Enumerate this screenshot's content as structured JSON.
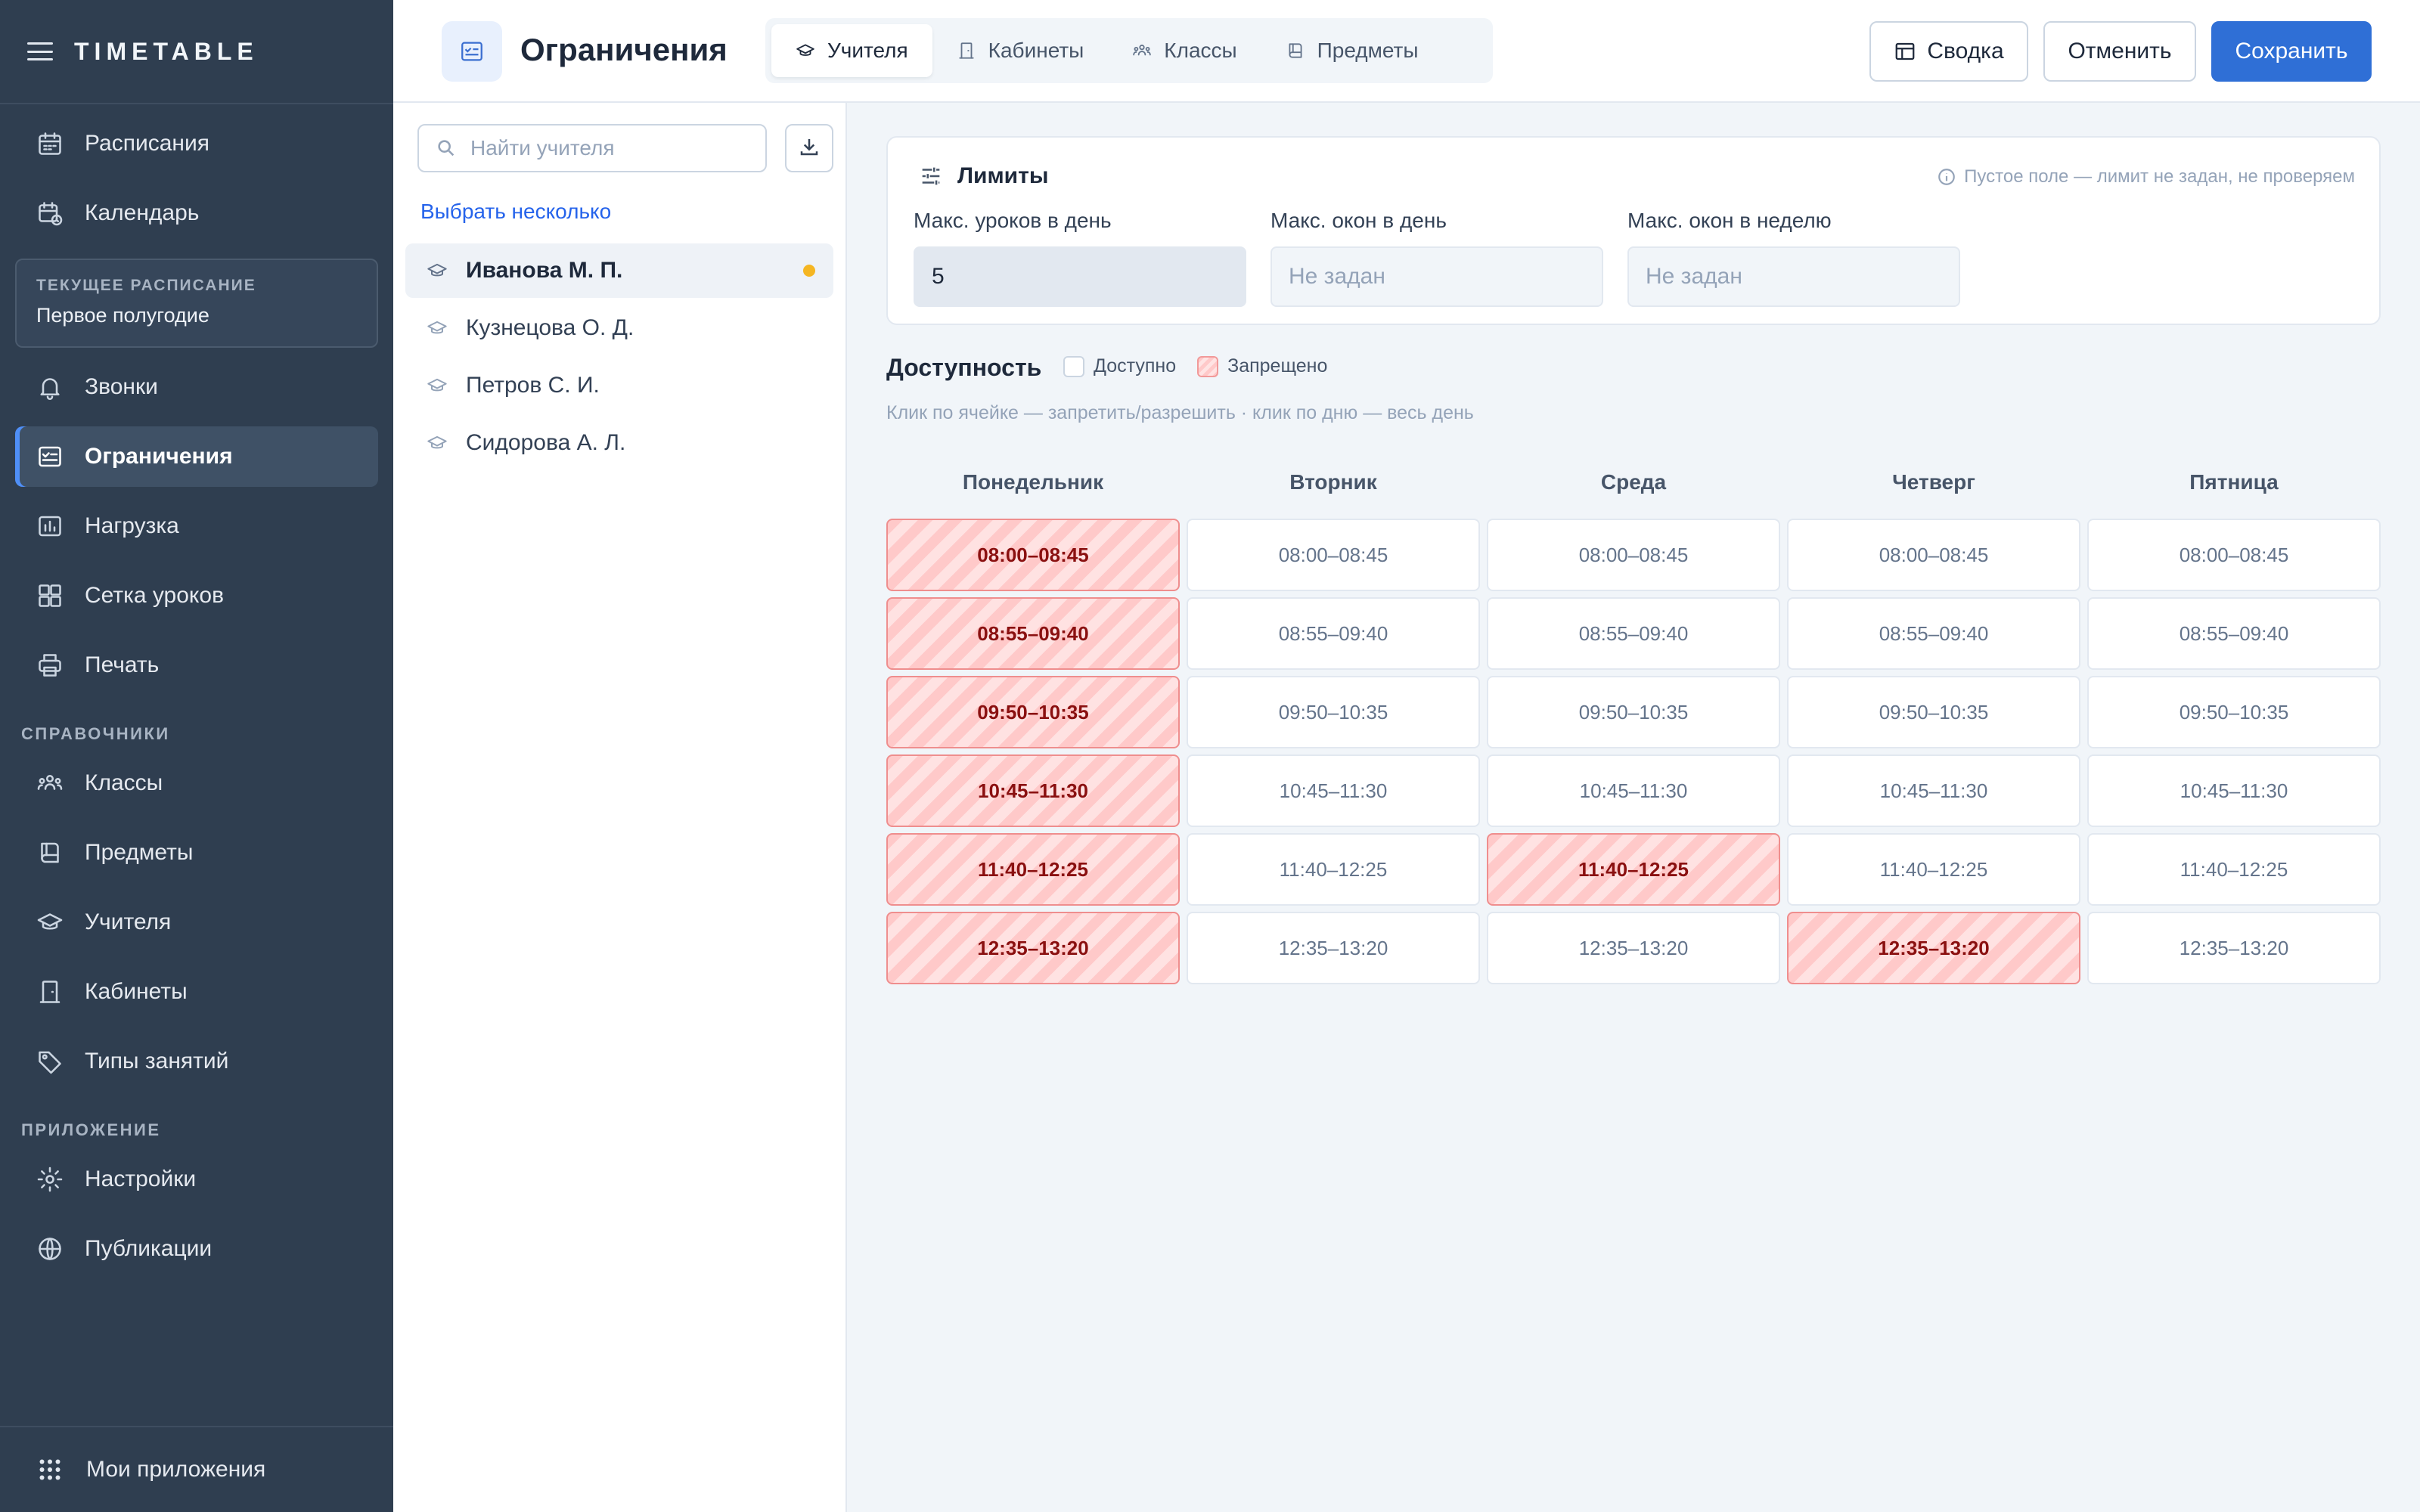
{
  "sidebar": {
    "brand": "TIMETABLE",
    "top_items": [
      {
        "label": "Расписания",
        "icon": "calendar-grid-icon"
      },
      {
        "label": "Календарь",
        "icon": "calendar-clock-icon"
      }
    ],
    "current_schedule": {
      "label": "ТЕКУЩЕЕ РАСПИСАНИЕ",
      "value": "Первое полугодие"
    },
    "main_items": [
      {
        "label": "Звонки",
        "icon": "bell-icon"
      },
      {
        "label": "Ограничения",
        "icon": "checklist-icon",
        "active": true
      },
      {
        "label": "Нагрузка",
        "icon": "bar-chart-icon"
      },
      {
        "label": "Сетка уроков",
        "icon": "grid-icon"
      },
      {
        "label": "Печать",
        "icon": "printer-icon"
      }
    ],
    "section_reference": "СПРАВОЧНИКИ",
    "reference_items": [
      {
        "label": "Классы",
        "icon": "people-icon"
      },
      {
        "label": "Предметы",
        "icon": "book-icon"
      },
      {
        "label": "Учителя",
        "icon": "graduation-cap-icon"
      },
      {
        "label": "Кабинеты",
        "icon": "door-icon"
      },
      {
        "label": "Типы занятий",
        "icon": "tag-icon"
      }
    ],
    "section_app": "ПРИЛОЖЕНИЕ",
    "app_items": [
      {
        "label": "Настройки",
        "icon": "gear-icon"
      },
      {
        "label": "Публикации",
        "icon": "globe-icon"
      }
    ],
    "bottom_item": {
      "label": "Мои приложения",
      "icon": "apps-grid-icon"
    }
  },
  "header": {
    "title": "Ограничения",
    "tabs": [
      {
        "label": "Учителя",
        "icon": "graduation-cap-icon",
        "active": true
      },
      {
        "label": "Кабинеты",
        "icon": "door-icon"
      },
      {
        "label": "Классы",
        "icon": "people-icon"
      },
      {
        "label": "Предметы",
        "icon": "book-icon"
      }
    ],
    "summary_label": "Сводка",
    "cancel_label": "Отменить",
    "save_label": "Сохранить"
  },
  "teachers": {
    "search_placeholder": "Найти учителя",
    "select_many": "Выбрать несколько",
    "list": [
      {
        "name": "Иванова М. П.",
        "active": true,
        "modified": true
      },
      {
        "name": "Кузнецова О. Д."
      },
      {
        "name": "Петров С. И."
      },
      {
        "name": "Сидорова А. Л."
      }
    ]
  },
  "limits": {
    "title": "Лимиты",
    "hint": "Пустое поле — лимит не задан, не проверяем",
    "fields": [
      {
        "label": "Макс. уроков в день",
        "value": "5",
        "placeholder": "Не задан"
      },
      {
        "label": "Макс. окон в день",
        "value": "",
        "placeholder": "Не задан"
      },
      {
        "label": "Макс. окон в неделю",
        "value": "",
        "placeholder": "Не задан"
      }
    ]
  },
  "availability": {
    "title": "Доступность",
    "legend_free": "Доступно",
    "legend_forbidden": "Запрещено",
    "hint": "Клик по ячейке — запретить/разрешить · клик по дню — весь день",
    "days": [
      "Понедельник",
      "Вторник",
      "Среда",
      "Четверг",
      "Пятница"
    ],
    "slots": [
      "08:00–08:45",
      "08:55–09:40",
      "09:50–10:35",
      "10:45–11:30",
      "11:40–12:25",
      "12:35–13:20"
    ],
    "forbidden": [
      [
        true,
        true,
        true,
        true,
        true,
        true
      ],
      [
        false,
        false,
        false,
        false,
        false,
        false
      ],
      [
        false,
        false,
        false,
        false,
        true,
        false
      ],
      [
        false,
        false,
        false,
        false,
        false,
        true
      ],
      [
        false,
        false,
        false,
        false,
        false,
        false
      ]
    ]
  },
  "colors": {
    "sidebar_bg": "#2f3e50",
    "accent": "#2f6fd6",
    "forbidden_border": "#ef8e8e",
    "modified_dot": "#f5b622"
  }
}
